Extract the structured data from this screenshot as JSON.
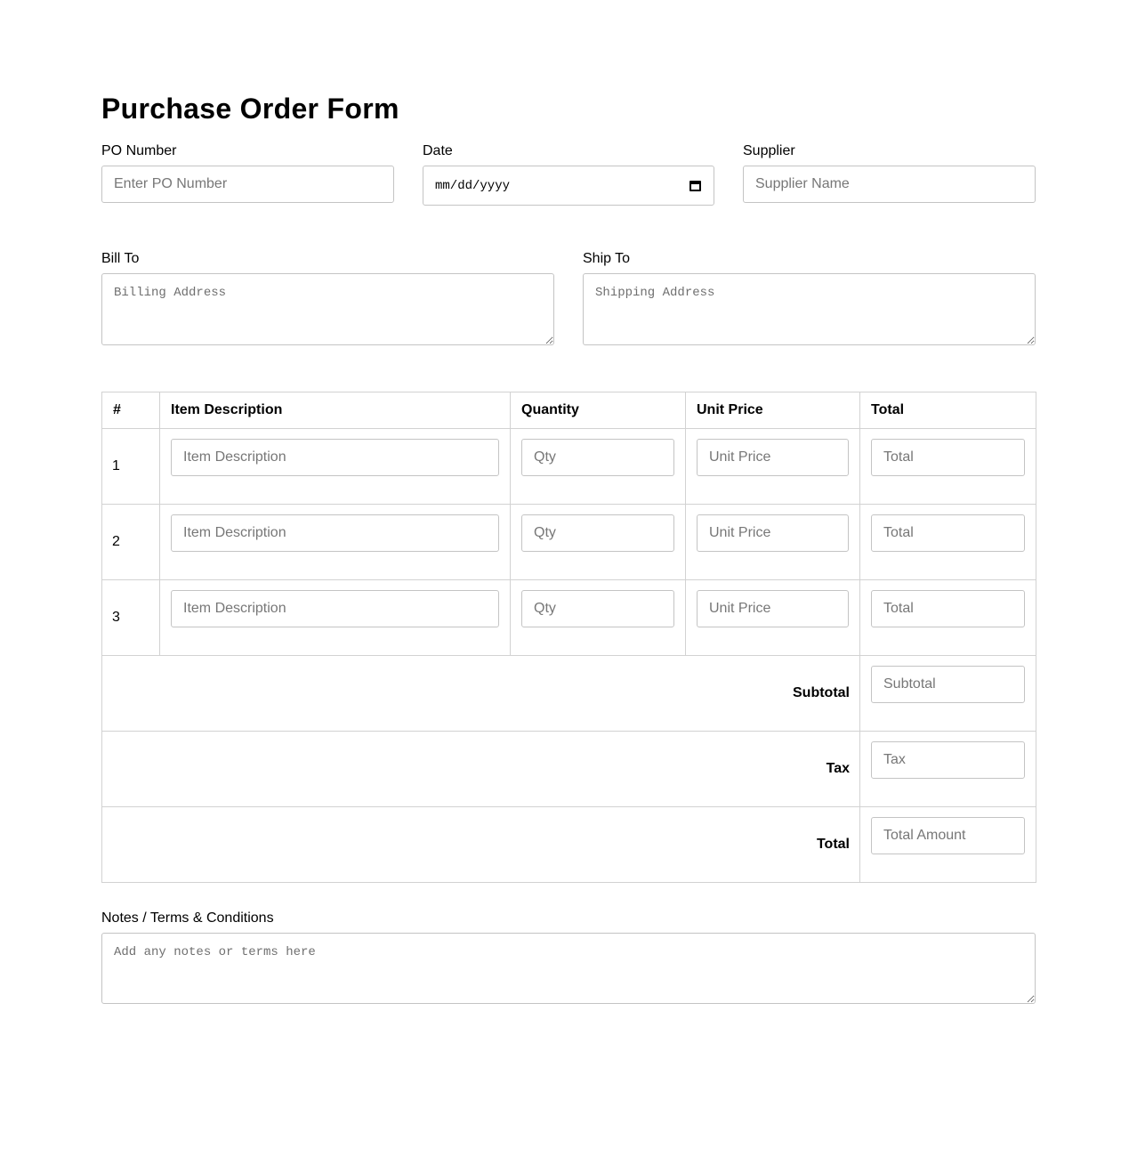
{
  "title": "Purchase Order Form",
  "po_number": {
    "label": "PO Number",
    "placeholder": "Enter PO Number"
  },
  "date": {
    "label": "Date",
    "value": "mm/dd/yyyy"
  },
  "supplier": {
    "label": "Supplier",
    "placeholder": "Supplier Name"
  },
  "bill_to": {
    "label": "Bill To",
    "placeholder": "Billing Address"
  },
  "ship_to": {
    "label": "Ship To",
    "placeholder": "Shipping Address"
  },
  "table": {
    "headers": [
      "#",
      "Item Description",
      "Quantity",
      "Unit Price",
      "Total"
    ],
    "rows": [
      {
        "num": "1",
        "description_placeholder": "Item Description",
        "qty_placeholder": "Qty",
        "unit_price_placeholder": "Unit Price",
        "total_placeholder": "Total"
      },
      {
        "num": "2",
        "description_placeholder": "Item Description",
        "qty_placeholder": "Qty",
        "unit_price_placeholder": "Unit Price",
        "total_placeholder": "Total"
      },
      {
        "num": "3",
        "description_placeholder": "Item Description",
        "qty_placeholder": "Qty",
        "unit_price_placeholder": "Unit Price",
        "total_placeholder": "Total"
      }
    ],
    "summary": [
      {
        "label": "Subtotal",
        "placeholder": "Subtotal"
      },
      {
        "label": "Tax",
        "placeholder": "Tax"
      },
      {
        "label": "Total",
        "placeholder": "Total Amount"
      }
    ]
  },
  "notes": {
    "label": "Notes / Terms & Conditions",
    "placeholder": "Add any notes or terms here"
  }
}
